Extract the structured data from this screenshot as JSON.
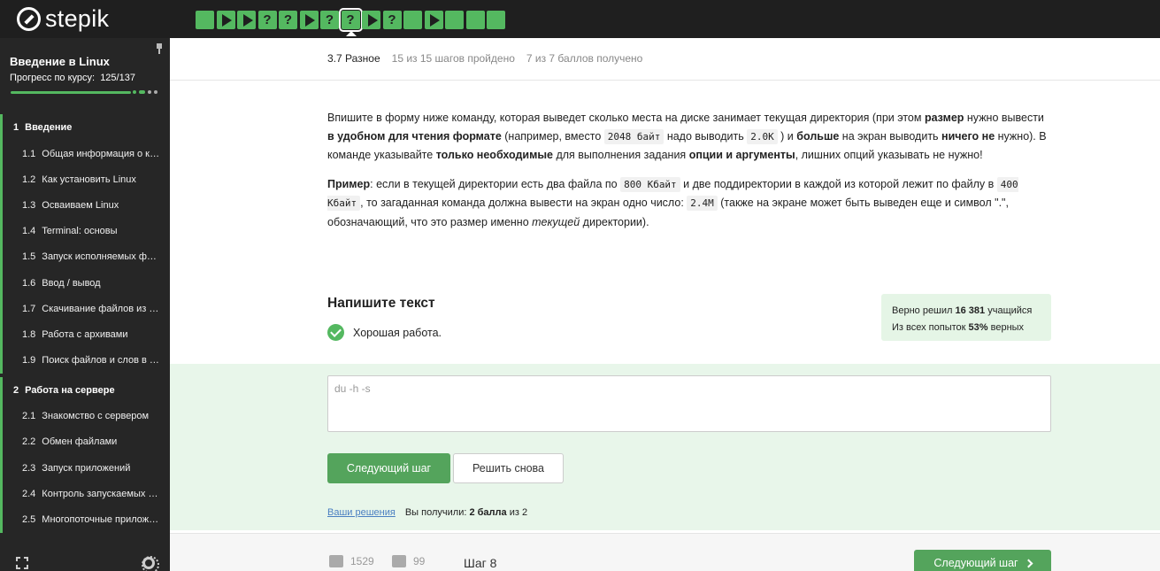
{
  "brand": {
    "name": "stepik"
  },
  "step_icons": [
    "check",
    "play",
    "play",
    "question",
    "question",
    "play",
    "question",
    "question",
    "play",
    "question",
    "check",
    "play",
    "check",
    "check",
    "check"
  ],
  "step_icon_glyphs": {
    "check": "",
    "play": "",
    "question": "?"
  },
  "active_step_index": 7,
  "sidebar": {
    "course_title": "Введение в Linux",
    "progress_label": "Прогресс по курсу:",
    "progress_value": "125/137",
    "progress_fraction": 0.912,
    "sections": [
      {
        "num": "1",
        "title": "Введение",
        "lessons": [
          {
            "num": "1.1",
            "title": "Общая информация о курсе"
          },
          {
            "num": "1.2",
            "title": "Как установить Linux"
          },
          {
            "num": "1.3",
            "title": "Осваиваем Linux"
          },
          {
            "num": "1.4",
            "title": "Terminal: основы"
          },
          {
            "num": "1.5",
            "title": "Запуск исполняемых файлов"
          },
          {
            "num": "1.6",
            "title": "Ввод / вывод"
          },
          {
            "num": "1.7",
            "title": "Скачивание файлов из Интернета"
          },
          {
            "num": "1.8",
            "title": "Работа с архивами"
          },
          {
            "num": "1.9",
            "title": "Поиск файлов и слов в файлах"
          }
        ]
      },
      {
        "num": "2",
        "title": "Работа на сервере",
        "lessons": [
          {
            "num": "2.1",
            "title": "Знакомство с сервером"
          },
          {
            "num": "2.2",
            "title": "Обмен файлами"
          },
          {
            "num": "2.3",
            "title": "Запуск приложений"
          },
          {
            "num": "2.4",
            "title": "Контроль запускаемых программ"
          },
          {
            "num": "2.5",
            "title": "Многопоточные приложения"
          }
        ]
      }
    ]
  },
  "header": {
    "lesson": "3.7 Разное",
    "steps_done": "15 из 15 шагов пройдено",
    "points": "7 из 7 баллов  получено"
  },
  "task": {
    "p1": [
      {
        "t": "Впишите в форму ниже команду, которая выведет сколько места на диске занимает текущая директория (при этом ",
        "s": ""
      },
      {
        "t": "размер",
        "s": "b"
      },
      {
        "t": " нужно вывести ",
        "s": ""
      },
      {
        "t": "в удобном для чтения формате",
        "s": "b"
      },
      {
        "t": " (например, вместо ",
        "s": ""
      },
      {
        "t": "2048 байт",
        "s": "code"
      },
      {
        "t": " надо выводить ",
        "s": ""
      },
      {
        "t": "2.0K",
        "s": "code"
      },
      {
        "t": " ) и ",
        "s": ""
      },
      {
        "t": "больше",
        "s": "b"
      },
      {
        "t": " на экран выводить ",
        "s": ""
      },
      {
        "t": "ничего не",
        "s": "b"
      },
      {
        "t": " нужно). В команде указывайте ",
        "s": ""
      },
      {
        "t": "только необходимые",
        "s": "b"
      },
      {
        "t": " для выполнения задания ",
        "s": ""
      },
      {
        "t": "опции и аргументы",
        "s": "b"
      },
      {
        "t": ", лишних опций указывать не нужно!",
        "s": ""
      }
    ],
    "p2": [
      {
        "t": "Пример",
        "s": "b"
      },
      {
        "t": ": если в текущей директории есть два файла по ",
        "s": ""
      },
      {
        "t": "800 Кбайт",
        "s": "code"
      },
      {
        "t": " и две поддиректории в каждой из которой лежит по файлу в ",
        "s": ""
      },
      {
        "t": "400 Кбайт",
        "s": "code"
      },
      {
        "t": ", то загаданная команда должна вывести на экран одно число: ",
        "s": ""
      },
      {
        "t": "2.4M",
        "s": "code"
      },
      {
        "t": " (также на экране может быть выведен еще и символ \".\", обозначающий, что это размер именно ",
        "s": ""
      },
      {
        "t": "текущей",
        "s": "i"
      },
      {
        "t": " директории).",
        "s": ""
      }
    ]
  },
  "answer": {
    "title": "Напишите текст",
    "success_text": "Хорошая работа.",
    "value": "du -h -s",
    "stats": {
      "solved_prefix": "Верно решил",
      "solved_count": "16 381",
      "solved_suffix": "учащийся",
      "attempts_prefix": "Из всех попыток",
      "attempts_percent": "53%",
      "attempts_suffix": "верных"
    },
    "next_button": "Следующий шаг",
    "retry_button": "Решить снова",
    "solutions_link": "Ваши решения",
    "received_prefix": "Вы получили:",
    "received_value": "2 балла",
    "received_suffix": "из 2"
  },
  "footer": {
    "likes": "1529",
    "dislikes": "99",
    "step_label": "Шаг 8",
    "next_button": "Следующий шаг"
  }
}
